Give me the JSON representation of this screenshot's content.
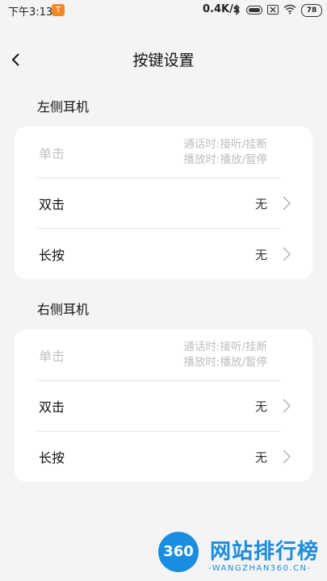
{
  "status_bar": {
    "time": "下午3:13",
    "app_badge": "T",
    "network_speed": "0.4K/s",
    "battery": "78"
  },
  "header": {
    "title": "按键设置"
  },
  "left_earphone": {
    "title": "左侧耳机",
    "single_tap": {
      "label": "单击",
      "desc_line1": "通话时:接听/挂断",
      "desc_line2": "播放时:播放/暂停"
    },
    "double_tap": {
      "label": "双击",
      "value": "无"
    },
    "long_press": {
      "label": "长按",
      "value": "无"
    }
  },
  "right_earphone": {
    "title": "右侧耳机",
    "single_tap": {
      "label": "单击",
      "desc_line1": "通话时:接听/挂断",
      "desc_line2": "播放时:播放/暂停"
    },
    "double_tap": {
      "label": "双击",
      "value": "无"
    },
    "long_press": {
      "label": "长按",
      "value": "无"
    }
  },
  "watermark": {
    "badge": "360",
    "name": "网站排行榜",
    "url": "-WANGZHAN360.CN-"
  },
  "colors": {
    "background": "#f4f4f4",
    "card": "#ffffff",
    "disabled_text": "#c2c2c2",
    "watermark_blue": "#1a8de0"
  }
}
